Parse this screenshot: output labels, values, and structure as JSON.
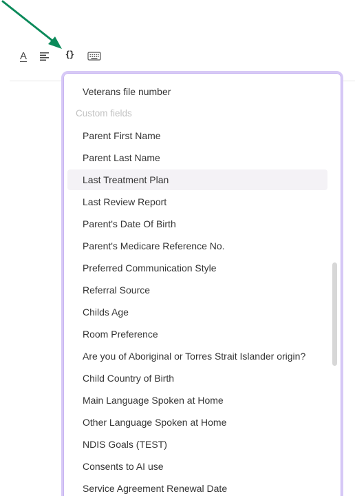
{
  "toolbar": {
    "text_color_glyph": "A",
    "variables_glyph": "{}",
    "icons": [
      "text-color-icon",
      "align-left-icon",
      "variables-icon",
      "keyboard-icon"
    ]
  },
  "annotation": {
    "arrow_color": "#0b8a5a"
  },
  "dropdown": {
    "border_color": "#d7c9f6",
    "section_label": "Custom fields",
    "items_before": [
      "Veterans file number"
    ],
    "items": [
      "Parent First Name",
      "Parent Last Name",
      "Last Treatment Plan",
      "Last Review Report",
      "Parent's Date Of Birth",
      "Parent's Medicare Reference No.",
      "Preferred Communication Style",
      "Referral Source",
      "Childs Age",
      "Room Preference",
      "Are you of Aboriginal or Torres Strait Islander origin?",
      "Child Country of Birth",
      "Main Language Spoken at Home",
      "Other Language Spoken at Home",
      "NDIS Goals (TEST)",
      "Consents to AI use",
      "Service Agreement Renewal Date"
    ],
    "highlighted_item": "Last Treatment Plan"
  }
}
